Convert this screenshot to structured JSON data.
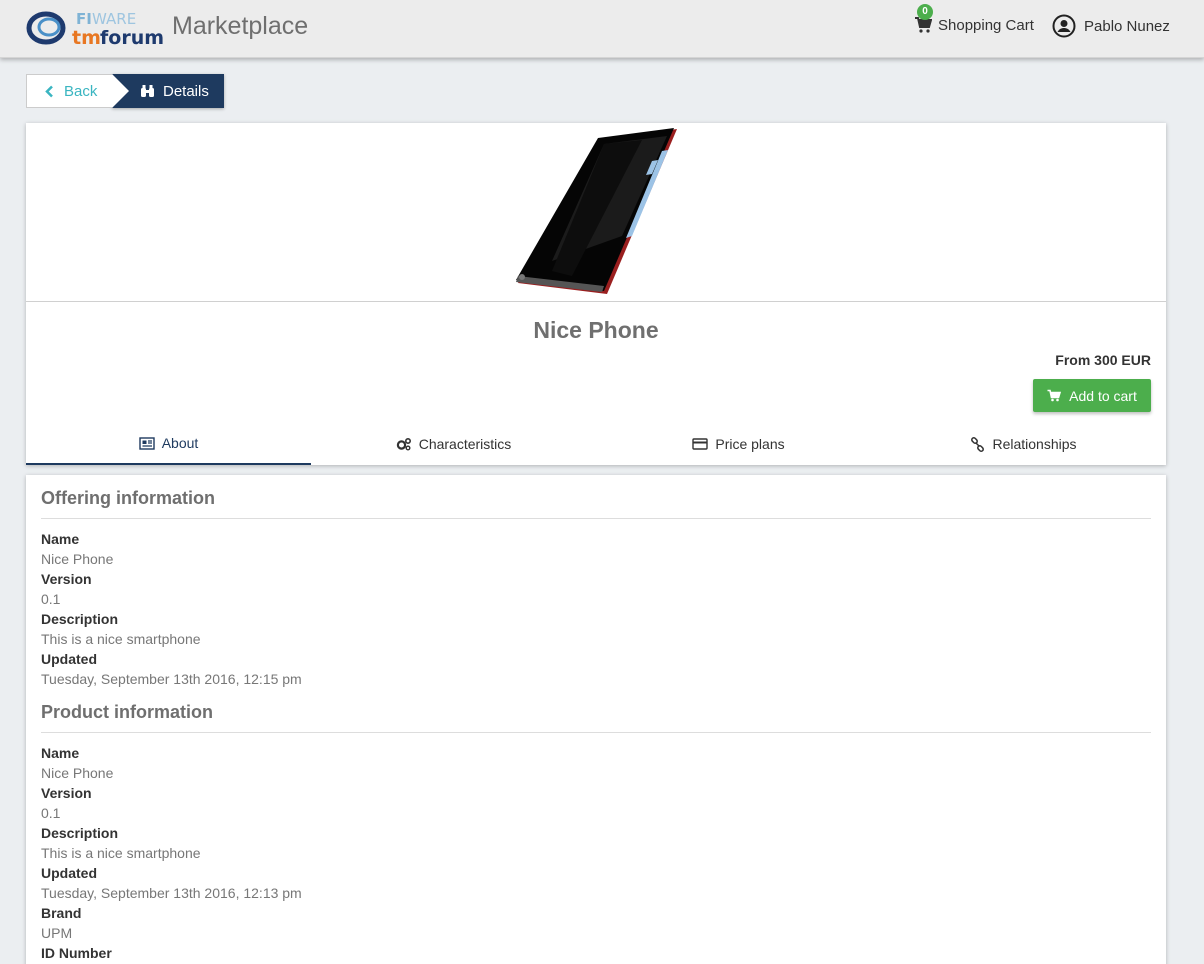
{
  "header": {
    "brand": "Marketplace",
    "cart_label": "Shopping Cart",
    "cart_count": "0",
    "user_name": "Pablo Nunez"
  },
  "breadcrumb": {
    "back": "Back",
    "current": "Details"
  },
  "offering": {
    "title": "Nice Phone",
    "price": "From 300 EUR",
    "add_to_cart": "Add to cart"
  },
  "tabs": [
    {
      "label": "About",
      "icon": "newspaper-icon",
      "active": true
    },
    {
      "label": "Characteristics",
      "icon": "cogs-icon",
      "active": false
    },
    {
      "label": "Price plans",
      "icon": "credit-card-icon",
      "active": false
    },
    {
      "label": "Relationships",
      "icon": "link-icon",
      "active": false
    }
  ],
  "offering_info": {
    "heading": "Offering information",
    "fields": [
      {
        "label": "Name",
        "value": "Nice Phone"
      },
      {
        "label": "Version",
        "value": "0.1"
      },
      {
        "label": "Description",
        "value": "This is a nice smartphone"
      },
      {
        "label": "Updated",
        "value": "Tuesday, September 13th 2016, 12:15 pm"
      }
    ]
  },
  "product_info": {
    "heading": "Product information",
    "fields": [
      {
        "label": "Name",
        "value": "Nice Phone"
      },
      {
        "label": "Version",
        "value": "0.1"
      },
      {
        "label": "Description",
        "value": "This is a nice smartphone"
      },
      {
        "label": "Updated",
        "value": "Tuesday, September 13th 2016, 12:13 pm"
      },
      {
        "label": "Brand",
        "value": "UPM"
      },
      {
        "label": "ID Number",
        "value": ""
      }
    ]
  },
  "colors": {
    "primary": "#1e3a5f",
    "accent": "#3ab5c1",
    "success": "#4cae4c"
  }
}
